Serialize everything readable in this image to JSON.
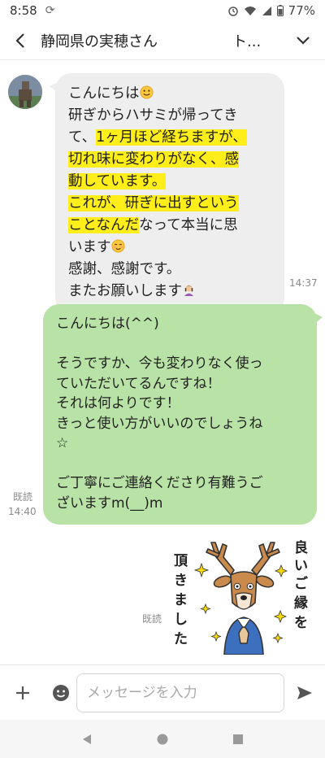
{
  "status": {
    "time": "8:58",
    "battery": "77%"
  },
  "header": {
    "back": "<",
    "title": "静岡県の実穂さん",
    "title_extra": "ト..."
  },
  "incoming": {
    "lines": [
      {
        "text": "こんにちは",
        "emoji": "smile-emoji"
      },
      {
        "text": "研ぎからハサミが帰ってき"
      },
      {
        "text_plain": "て、",
        "text_hl": "1ヶ月ほど経ちますが、"
      },
      {
        "text_hl": "切れ味に変わりがなく、感"
      },
      {
        "text_hl": "動しています。"
      },
      {
        "text_hl": "これが、研ぎに出すという"
      },
      {
        "text_hl": "ことなんだ",
        "text_plain": "なって本当に思"
      },
      {
        "text": "います",
        "emoji": "blush-emoji"
      },
      {
        "text": "感謝、感謝です。"
      },
      {
        "text": "またお願いします",
        "emoji": "bowing-woman-emoji"
      }
    ],
    "time": "14:37"
  },
  "outgoing": {
    "lines": [
      "こんにちは(^^)",
      "",
      "そうですか、今も変わりなく使っ",
      "ていただいてるんですね！",
      "それは何よりです！",
      "きっと使い方がいいのでしょうね",
      "☆",
      "",
      "ご丁寧にご連絡くださり有難うご",
      "ざいますm(__)m"
    ],
    "read": "既読",
    "time": "14:40"
  },
  "sticker": {
    "text_right": "良いご縁を",
    "text_left": "頂きました",
    "read": "既読"
  },
  "input": {
    "placeholder": "メッセージを入力"
  },
  "colors": {
    "incoming_bubble": "#eeeeee",
    "outgoing_bubble": "#b8e2a6",
    "highlight": "#ffee1a"
  }
}
